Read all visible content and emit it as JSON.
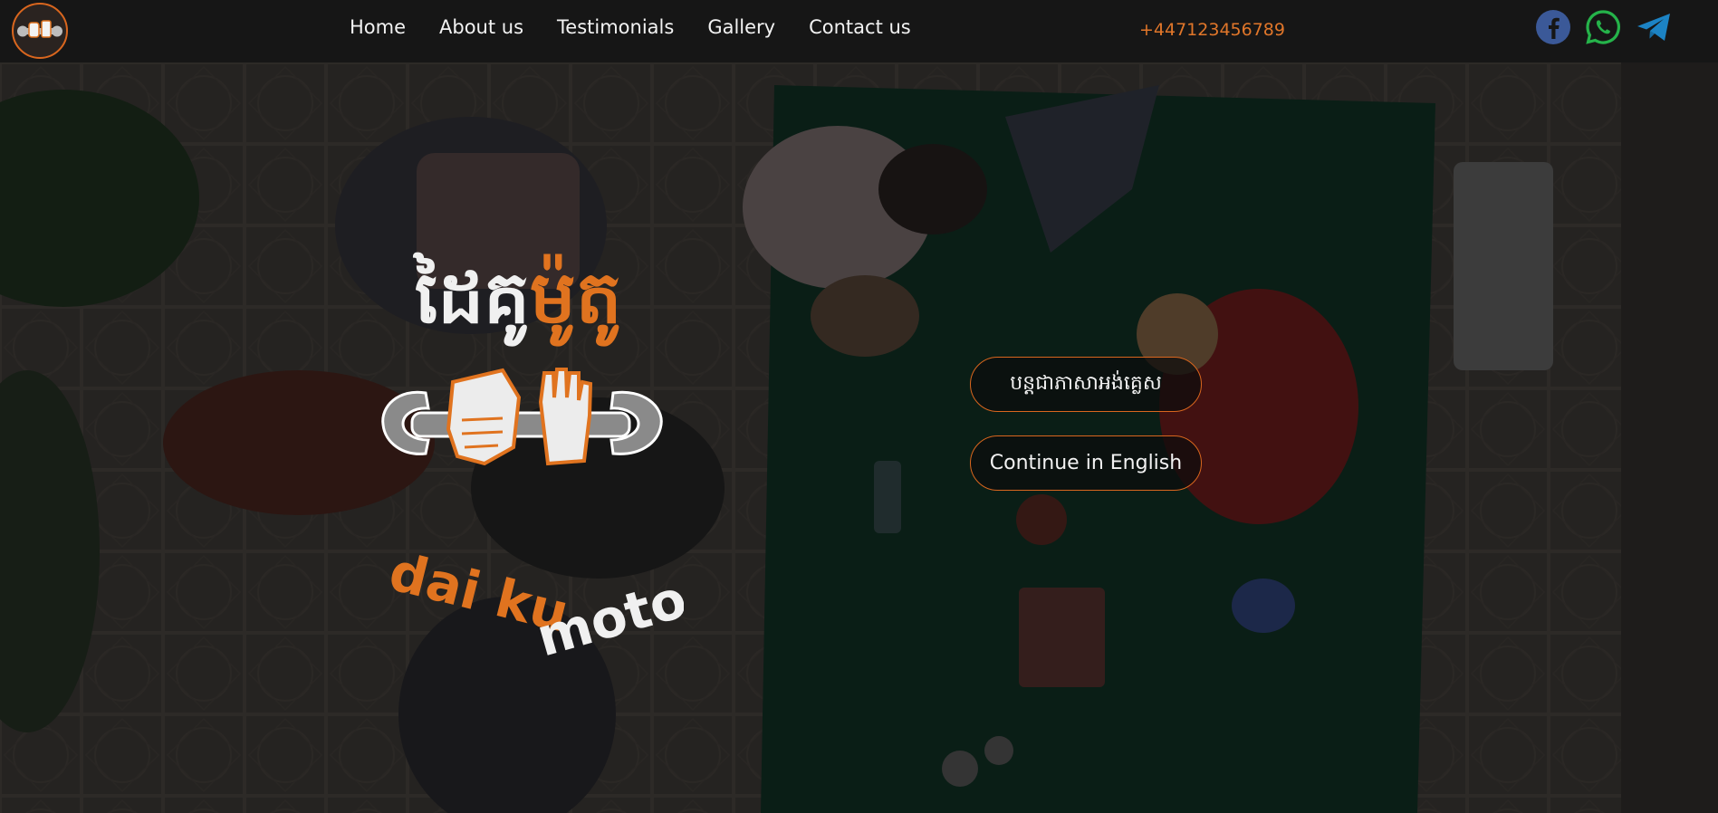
{
  "header": {
    "logo_alt": "daiku moto",
    "nav": [
      {
        "label": "Home"
      },
      {
        "label": "About us"
      },
      {
        "label": "Testimonials"
      },
      {
        "label": "Gallery"
      },
      {
        "label": "Contact us"
      }
    ],
    "phone": "+447123456789",
    "social": [
      {
        "icon": "facebook-icon",
        "color": "#3b5998"
      },
      {
        "icon": "whatsapp-icon",
        "color": "#25b34a"
      },
      {
        "icon": "telegram-icon",
        "color": "#1c83c4"
      }
    ]
  },
  "hero": {
    "logo": {
      "khmer_white": "ដៃគូ",
      "khmer_orange": "ម៉ូតូ",
      "latin_orange": "dai ku",
      "latin_white": "moto"
    },
    "buttons": {
      "khmer": "បន្តជាភាសាអង់គ្លេស",
      "english": "Continue in English"
    }
  },
  "colors": {
    "accent": "#e0762a",
    "header_bg": "#161616"
  }
}
